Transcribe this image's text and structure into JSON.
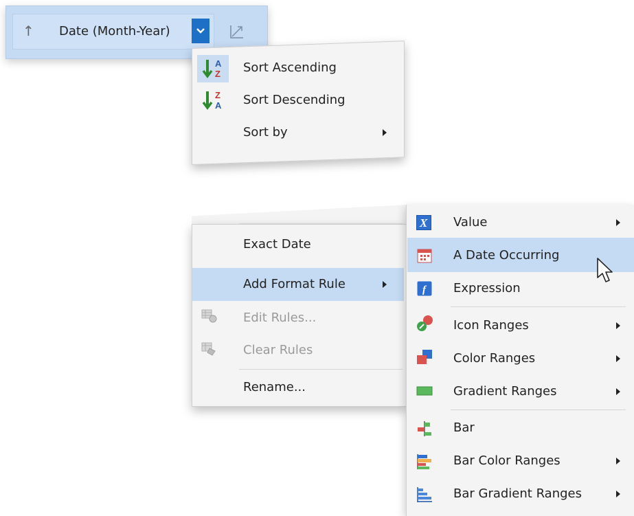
{
  "field_header": {
    "label": "Date (Month-Year)",
    "sort_arrow": "↑",
    "dropdown_glyph": "⌄"
  },
  "sort_menu": {
    "items": [
      {
        "label": "Sort Ascending",
        "icon": "sort-ascending-icon"
      },
      {
        "label": "Sort Descending",
        "icon": "sort-descending-icon"
      },
      {
        "label": "Sort by",
        "has_submenu": true
      }
    ]
  },
  "context_menu": {
    "items": [
      {
        "label": "Exact Date"
      },
      {
        "label": "Add Format Rule",
        "has_submenu": true,
        "highlighted": true
      },
      {
        "label": "Edit Rules...",
        "disabled": true,
        "icon": "edit-rules-icon"
      },
      {
        "label": "Clear Rules",
        "disabled": true,
        "icon": "clear-rules-icon"
      },
      {
        "label": "Rename..."
      }
    ]
  },
  "format_submenu": {
    "items": [
      {
        "label": "Value",
        "has_submenu": true,
        "icon": "value-x-icon"
      },
      {
        "label": "A Date Occurring",
        "highlighted": true,
        "icon": "calendar-icon"
      },
      {
        "label": "Expression",
        "icon": "function-icon"
      },
      {
        "label": "Icon Ranges",
        "has_submenu": true,
        "icon": "icon-ranges-icon"
      },
      {
        "label": "Color Ranges",
        "has_submenu": true,
        "icon": "color-ranges-icon"
      },
      {
        "label": "Gradient Ranges",
        "has_submenu": true,
        "icon": "gradient-ranges-icon"
      },
      {
        "label": "Bar",
        "icon": "bar-icon"
      },
      {
        "label": "Bar Color Ranges",
        "has_submenu": true,
        "icon": "bar-color-ranges-icon"
      },
      {
        "label": "Bar Gradient Ranges",
        "has_submenu": true,
        "icon": "bar-gradient-ranges-icon"
      }
    ]
  },
  "colors": {
    "highlight": "#c5daf3",
    "accent": "#1e6fc6",
    "menu_bg": "#f4f4f4"
  }
}
